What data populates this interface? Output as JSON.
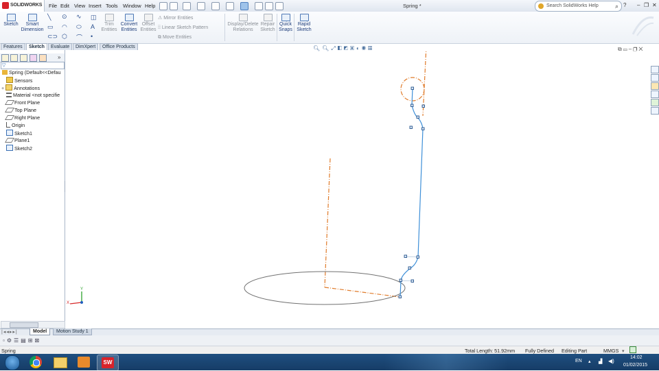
{
  "titlebar": {
    "logo_text": "SOLIDWORKS",
    "menu": [
      "File",
      "Edit",
      "View",
      "Insert",
      "Tools",
      "Window",
      "Help"
    ],
    "document_title": "Spring *",
    "search_placeholder": "Search SolidWorks Help"
  },
  "commands": {
    "sketch": "Sketch",
    "smart_dimension": [
      "Smart",
      "Dimension"
    ],
    "trim_entities": [
      "Trim",
      "Entities"
    ],
    "convert_entities": [
      "Convert",
      "Entities"
    ],
    "offset_entities": [
      "Offset",
      "Entities"
    ],
    "mirror_entities": "Mirror Entities",
    "linear_sketch_pattern": "Linear Sketch Pattern",
    "move_entities": "Move Entities",
    "display_delete_relations": [
      "Display/Delete",
      "Relations"
    ],
    "repair_sketch": [
      "Repair",
      "Sketch"
    ],
    "quick_snaps": [
      "Quick",
      "Snaps"
    ],
    "rapid_sketch": [
      "Rapid",
      "Sketch"
    ]
  },
  "tabs": [
    "Features",
    "Sketch",
    "Evaluate",
    "DimXpert",
    "Office Products"
  ],
  "active_tab": "Sketch",
  "tree": {
    "root": "Spring  (Default<<Defau",
    "items": [
      {
        "label": "Sensors",
        "icon": "sensor-folder-icon"
      },
      {
        "label": "Annotations",
        "icon": "annotations-icon"
      },
      {
        "label": "Material <not specifie",
        "icon": "material-icon"
      },
      {
        "label": "Front Plane",
        "icon": "plane-icon"
      },
      {
        "label": "Top Plane",
        "icon": "plane-icon"
      },
      {
        "label": "Right Plane",
        "icon": "plane-icon"
      },
      {
        "label": "Origin",
        "icon": "origin-icon"
      },
      {
        "label": "Sketch1",
        "icon": "sketch-icon"
      },
      {
        "label": "Plane1",
        "icon": "plane-icon"
      },
      {
        "label": "Sketch2",
        "icon": "sketch-icon"
      }
    ]
  },
  "model_tabs": [
    "Model",
    "Motion Study 1"
  ],
  "status": {
    "left": "Spring",
    "total_length": "Total Length: 51.92mm",
    "fully_defined": "Fully Defined",
    "editing": "Editing Part",
    "units": "MMGS"
  },
  "taskbar": {
    "language": "EN",
    "time": "14:02",
    "date": "01/02/2015"
  },
  "triad": {
    "x_label": "X",
    "y_label": "Y"
  },
  "colors": {
    "spline": "#3d8fd8",
    "centerline": "#e07b2a",
    "ellipse": "#707070",
    "brand": "#d8232a"
  }
}
